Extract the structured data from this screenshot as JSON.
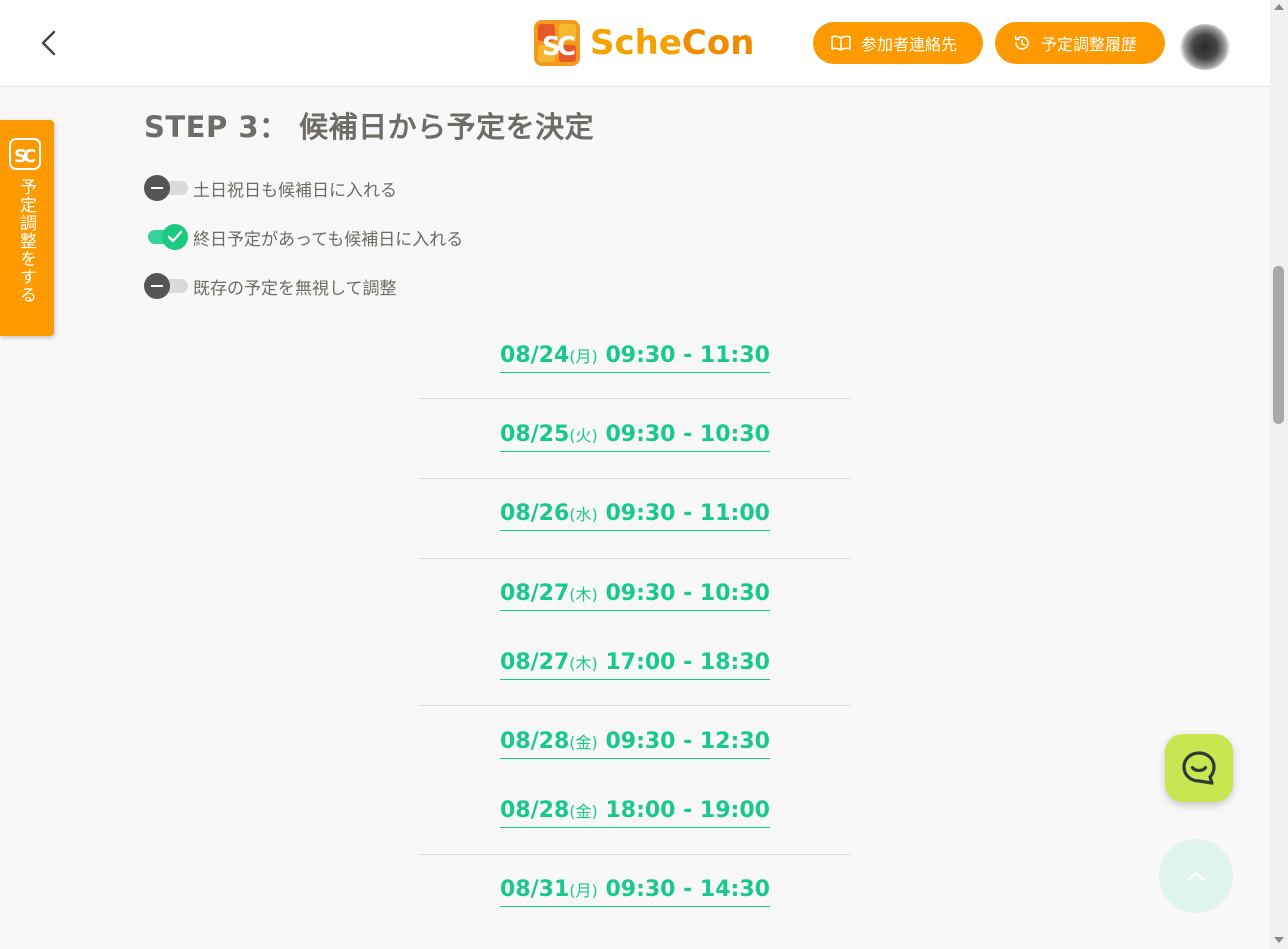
{
  "header": {
    "logo_text_a": "Sche",
    "logo_text_b": "Con",
    "contacts_label": "参加者連絡先",
    "history_label": "予定調整履歴"
  },
  "side_tab": {
    "label": "予定調整をする"
  },
  "step": {
    "title": "STEP 3： 候補日から予定を決定"
  },
  "toggles": [
    {
      "label": "土日祝日も候補日に入れる",
      "state": "off"
    },
    {
      "label": "終日予定があっても候補日に入れる",
      "state": "on"
    },
    {
      "label": "既存の予定を無視して調整",
      "state": "off"
    }
  ],
  "slots": [
    {
      "date": "08/24",
      "dow": "(月)",
      "time": " 09:30 - 11:30"
    },
    {
      "date": "08/25",
      "dow": "(火)",
      "time": " 09:30 - 10:30"
    },
    {
      "date": "08/26",
      "dow": "(水)",
      "time": " 09:30 - 11:00"
    },
    {
      "date": "08/27",
      "dow": "(木)",
      "time": " 09:30 - 10:30"
    },
    {
      "date": "08/27",
      "dow": "(木)",
      "time": " 17:00 - 18:30"
    },
    {
      "date": "08/28",
      "dow": "(金)",
      "time": " 09:30 - 12:30"
    },
    {
      "date": "08/28",
      "dow": "(金)",
      "time": " 18:00 - 19:00"
    },
    {
      "date": "08/31",
      "dow": "(月)",
      "time": " 09:30 - 14:30"
    }
  ],
  "colors": {
    "accent": "#fd9a00",
    "slot_green": "#19c98a",
    "chat_fab": "#c8e650"
  }
}
